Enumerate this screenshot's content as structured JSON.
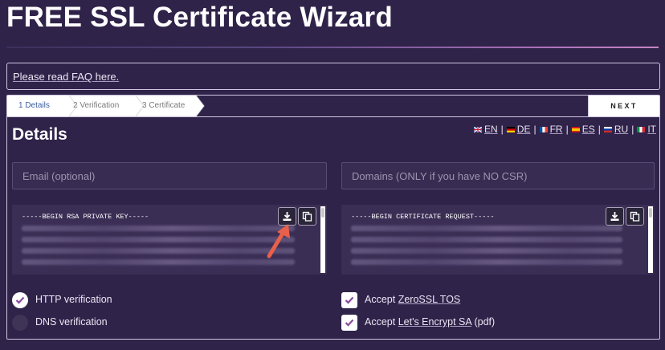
{
  "page": {
    "title": "FREE SSL Certificate Wizard"
  },
  "faq": {
    "link": "Please read FAQ here."
  },
  "steps": {
    "items": [
      {
        "label": "1  Details",
        "active": true
      },
      {
        "label": "2  Verification",
        "active": false
      },
      {
        "label": "3  Certificate",
        "active": false
      }
    ],
    "next": "NEXT"
  },
  "details": {
    "title": "Details",
    "languages": [
      "EN",
      "DE",
      "FR",
      "ES",
      "RU",
      "IT"
    ],
    "separator": "|",
    "email_placeholder": "Email (optional)",
    "domains_placeholder": "Domains (ONLY if you have NO CSR)",
    "private_key_header": "-----BEGIN RSA PRIVATE KEY-----",
    "csr_header": "-----BEGIN CERTIFICATE REQUEST-----"
  },
  "options": {
    "http_verification": "HTTP verification",
    "dns_verification": "DNS verification",
    "accept_prefix": "Accept ",
    "zerossl_tos_link": "ZeroSSL TOS",
    "letsencrypt_link": "Let's Encrypt SA",
    "letsencrypt_suffix": " (pdf)"
  },
  "state": {
    "http_verification_checked": true,
    "dns_verification_checked": false,
    "accept_zerossl_tos_checked": true,
    "accept_letsencrypt_checked": true
  },
  "icons": {
    "download": "download-icon",
    "copy": "copy-icon",
    "annotation": "red-arrow-annotation",
    "check": "check-icon"
  },
  "colors": {
    "background": "#30234a",
    "check_mark": "#8b4a9e",
    "annotation_arrow": "#e8604c",
    "active_step": "#3a5f9e"
  }
}
